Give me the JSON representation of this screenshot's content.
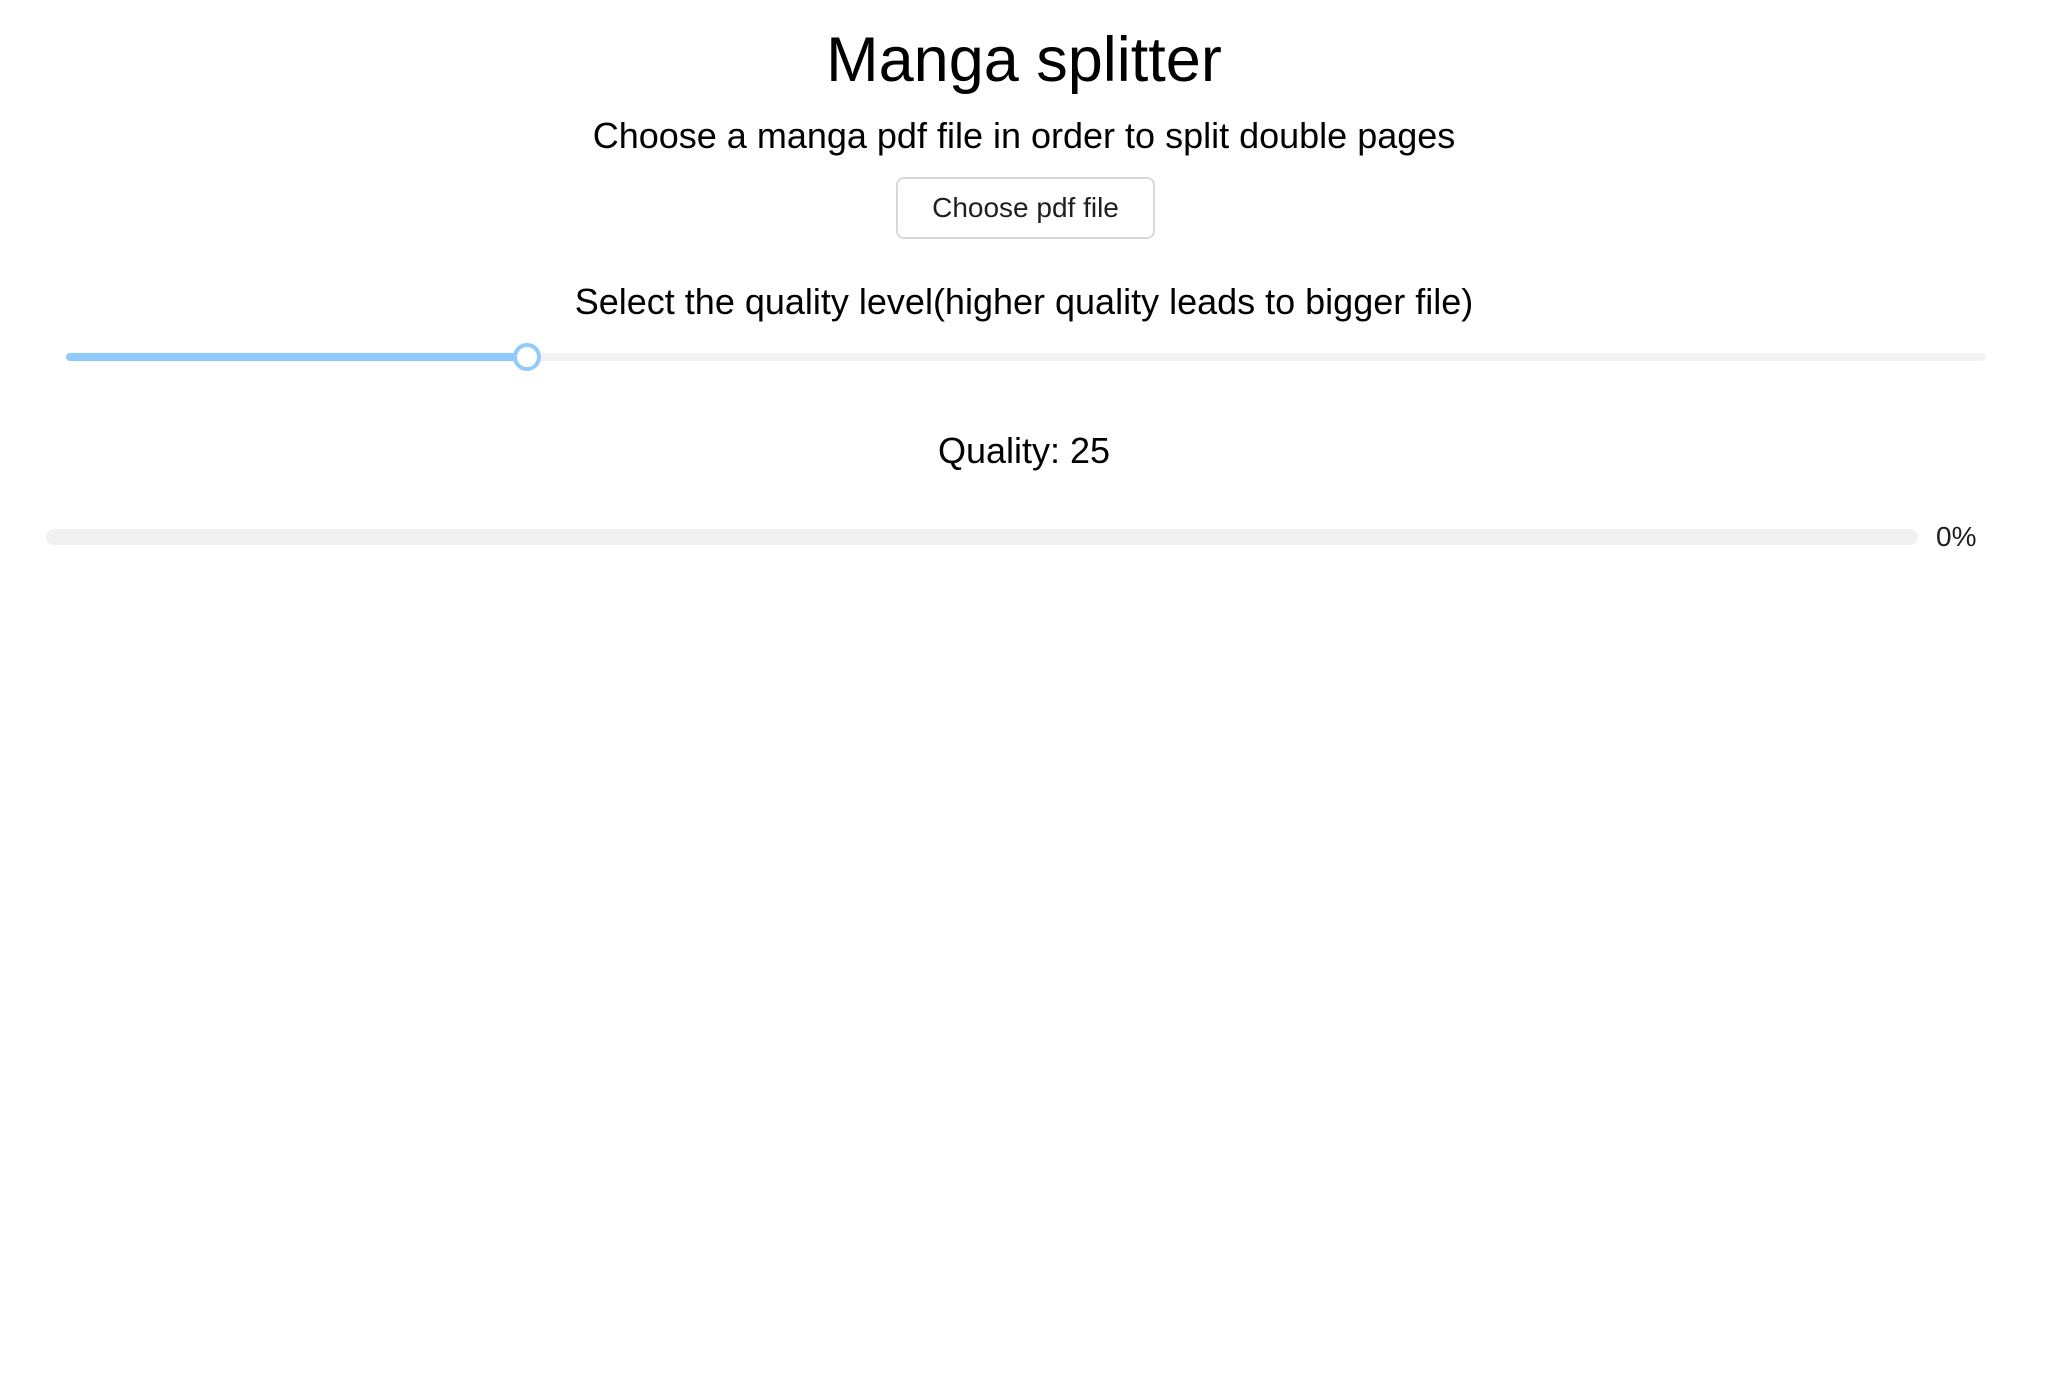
{
  "header": {
    "title": "Manga splitter",
    "subtitle": "Choose a manga pdf file in order to split double pages"
  },
  "upload": {
    "button_label": "Choose pdf file"
  },
  "quality": {
    "label": "Select the quality level(higher quality leads to bigger file)",
    "value_text": "Quality: 25",
    "slider_fraction": 0.24,
    "accent_color": "#91caff"
  },
  "progress": {
    "percent_text": "0%",
    "percent": 0,
    "rail_color": "#f0f0f0"
  }
}
